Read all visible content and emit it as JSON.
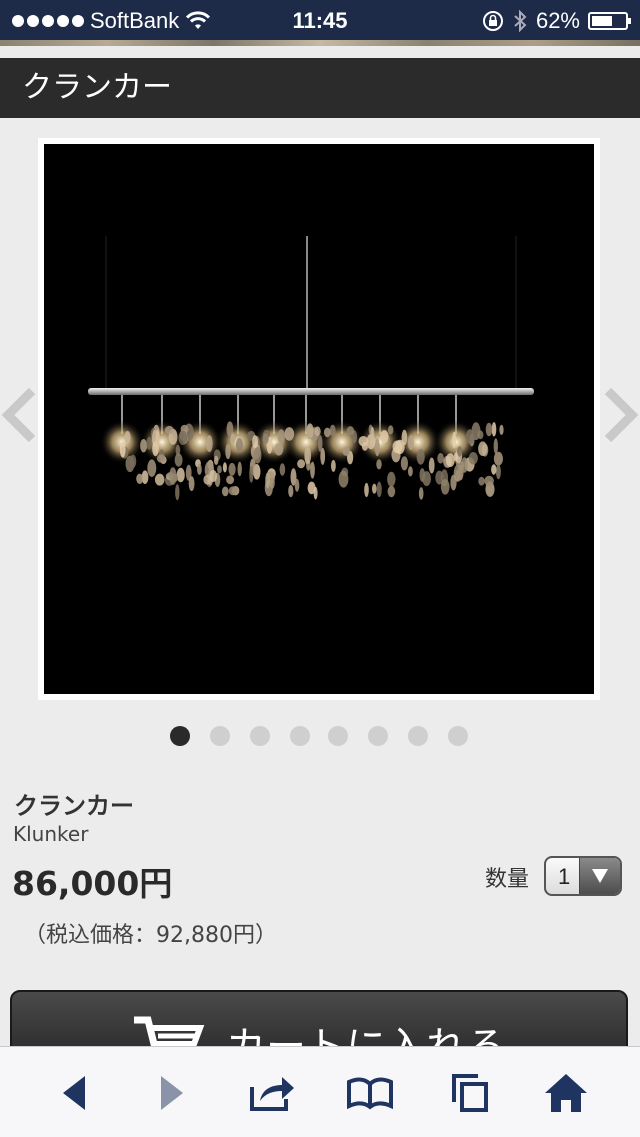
{
  "status_bar": {
    "carrier": "SoftBank",
    "time": "11:45",
    "battery_percent": "62%",
    "battery_level": 0.62,
    "signal_bars": 5
  },
  "header": {
    "title": "クランカー"
  },
  "gallery": {
    "image_count": 8,
    "active_index": 0
  },
  "product": {
    "name": "クランカー",
    "name_en": "Klunker",
    "price": "86,000円",
    "tax_included": "（税込価格：92,880円）"
  },
  "quantity": {
    "label": "数量",
    "value": "1"
  },
  "cart": {
    "label": "カートに入れる"
  },
  "colors": {
    "status_bar": "#1d2b49",
    "header_bg": "#2b2b2b",
    "page_bg": "#ececec",
    "toolbar_icon": "#1f3461"
  },
  "toolbar": {
    "icons": [
      "back-icon",
      "forward-icon",
      "share-icon",
      "bookmarks-icon",
      "tabs-icon",
      "home-icon"
    ]
  }
}
